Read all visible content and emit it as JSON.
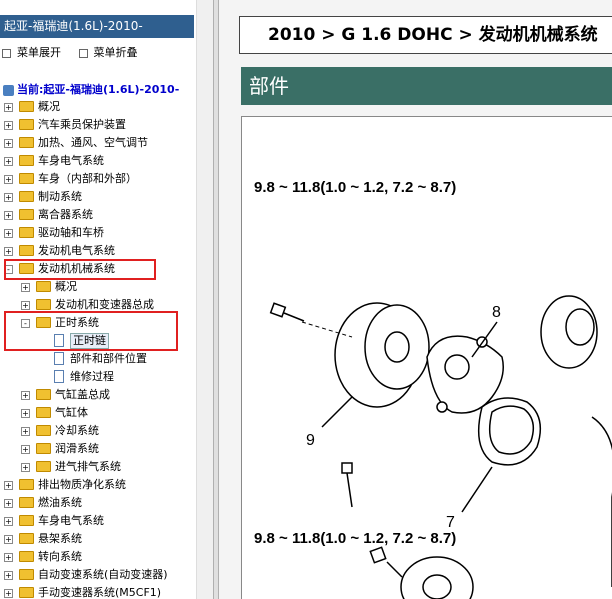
{
  "left": {
    "title": "起亚-福瑞迪(1.6L)-2010-",
    "toolbar": {
      "expand": "菜单展开",
      "collapse": "菜单折叠"
    },
    "current": "当前:起亚-福瑞迪(1.6L)-2010-",
    "tree": [
      {
        "label": "概况",
        "type": "folder",
        "level": 0,
        "pm": "+"
      },
      {
        "label": "汽车乘员保护装置",
        "type": "folder",
        "level": 0,
        "pm": "+"
      },
      {
        "label": "加热、通风、空气调节",
        "type": "folder",
        "level": 0,
        "pm": "+"
      },
      {
        "label": "车身电气系统",
        "type": "folder",
        "level": 0,
        "pm": "+"
      },
      {
        "label": "车身（内部和外部）",
        "type": "folder",
        "level": 0,
        "pm": "+"
      },
      {
        "label": "制动系统",
        "type": "folder",
        "level": 0,
        "pm": "+"
      },
      {
        "label": "离合器系统",
        "type": "folder",
        "level": 0,
        "pm": "+"
      },
      {
        "label": "驱动轴和车桥",
        "type": "folder",
        "level": 0,
        "pm": "+"
      },
      {
        "label": "发动机电气系统",
        "type": "folder",
        "level": 0,
        "pm": "+"
      },
      {
        "label": "发动机机械系统",
        "type": "folder",
        "level": 0,
        "pm": "-"
      },
      {
        "label": "概况",
        "type": "folder",
        "level": 1,
        "pm": "+"
      },
      {
        "label": "发动机和变速器总成",
        "type": "folder",
        "level": 1,
        "pm": "+"
      },
      {
        "label": "正时系统",
        "type": "folder",
        "level": 1,
        "pm": "-"
      },
      {
        "label": "正时链",
        "type": "doc",
        "level": 2,
        "selected": true
      },
      {
        "label": "部件和部件位置",
        "type": "doc",
        "level": 2
      },
      {
        "label": "维修过程",
        "type": "doc",
        "level": 2
      },
      {
        "label": "气缸盖总成",
        "type": "folder",
        "level": 1,
        "pm": "+"
      },
      {
        "label": "气缸体",
        "type": "folder",
        "level": 1,
        "pm": "+"
      },
      {
        "label": "冷却系统",
        "type": "folder",
        "level": 1,
        "pm": "+"
      },
      {
        "label": "润滑系统",
        "type": "folder",
        "level": 1,
        "pm": "+"
      },
      {
        "label": "进气排气系统",
        "type": "folder",
        "level": 1,
        "pm": "+"
      },
      {
        "label": "排出物质净化系统",
        "type": "folder",
        "level": 0,
        "pm": "+"
      },
      {
        "label": "燃油系统",
        "type": "folder",
        "level": 0,
        "pm": "+"
      },
      {
        "label": "车身电气系统",
        "type": "folder",
        "level": 0,
        "pm": "+"
      },
      {
        "label": "悬架系统",
        "type": "folder",
        "level": 0,
        "pm": "+"
      },
      {
        "label": "转向系统",
        "type": "folder",
        "level": 0,
        "pm": "+"
      },
      {
        "label": "自动变速系统(自动变速器)",
        "type": "folder",
        "level": 0,
        "pm": "+"
      },
      {
        "label": "手动变速器系统(M5CF1)",
        "type": "folder",
        "level": 0,
        "pm": "+"
      }
    ]
  },
  "right": {
    "header": "2010 > G 1.6 DOHC > 发动机机械系统",
    "section": "部件",
    "figure": {
      "torque_top": "9.8 ~ 11.8(1.0 ~ 1.2, 7.2 ~ 8.7)",
      "torque_bottom": "9.8 ~ 11.8(1.0 ~ 1.2, 7.2 ~ 8.7)",
      "callouts": [
        "8",
        "9",
        "7"
      ]
    }
  },
  "colors": {
    "title_bg": "#2f5f8f",
    "section_bg": "#3a6f66",
    "highlight": "#e02020",
    "current_text": "#0000cc"
  }
}
